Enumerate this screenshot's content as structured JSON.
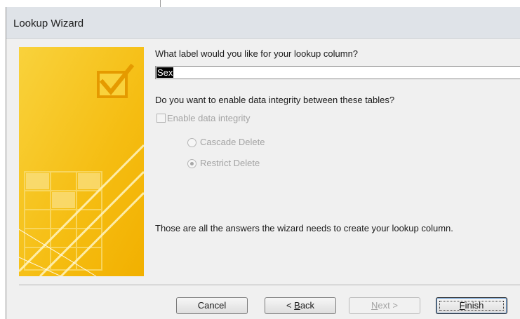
{
  "window": {
    "title": "Lookup Wizard"
  },
  "banner": {
    "icon": "checkbox-check-icon",
    "accent": "#f5b800",
    "accent_light": "#f9d64a"
  },
  "form": {
    "label_prompt": "What label would you like for your lookup column?",
    "label_value": "Sex",
    "integrity_question": "Do you want to enable data integrity between these tables?",
    "enable_integrity_label": "Enable data integrity",
    "enable_integrity_checked": false,
    "cascade_delete_label": "Cascade Delete",
    "restrict_delete_label": "Restrict Delete",
    "selected_delete_option": "Restrict Delete",
    "finish_note": "Those are all the answers the wizard needs to create your lookup column."
  },
  "buttons": {
    "cancel": "Cancel",
    "back_prefix": "< ",
    "back_accel": "B",
    "back_rest": "ack",
    "next": "Next >",
    "next_accel": "N",
    "next_rest": "ext >",
    "finish_accel": "F",
    "finish_rest": "inish"
  }
}
